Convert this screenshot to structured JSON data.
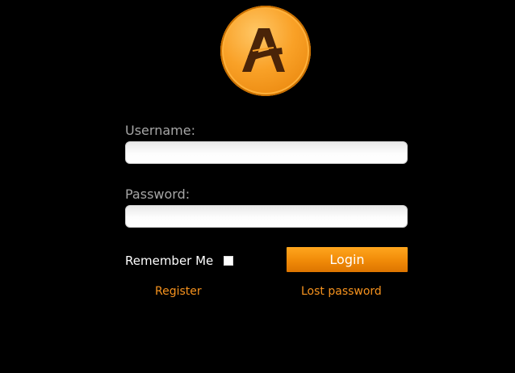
{
  "logo": {
    "letter": "A",
    "icon": "app-logo-icon",
    "colors": {
      "outer": "#e57f06",
      "inner": "#ffc766",
      "letter": "#4a2408"
    }
  },
  "form": {
    "username_label": "Username:",
    "username_value": "",
    "password_label": "Password:",
    "password_value": "",
    "remember_label": "Remember Me",
    "remember_checked": false,
    "login_label": "Login"
  },
  "links": {
    "register": "Register",
    "lost_password": "Lost password"
  },
  "colors": {
    "background": "#000000",
    "accent": "#f7931e",
    "label": "#a6a6a6",
    "text": "#ffffff"
  }
}
